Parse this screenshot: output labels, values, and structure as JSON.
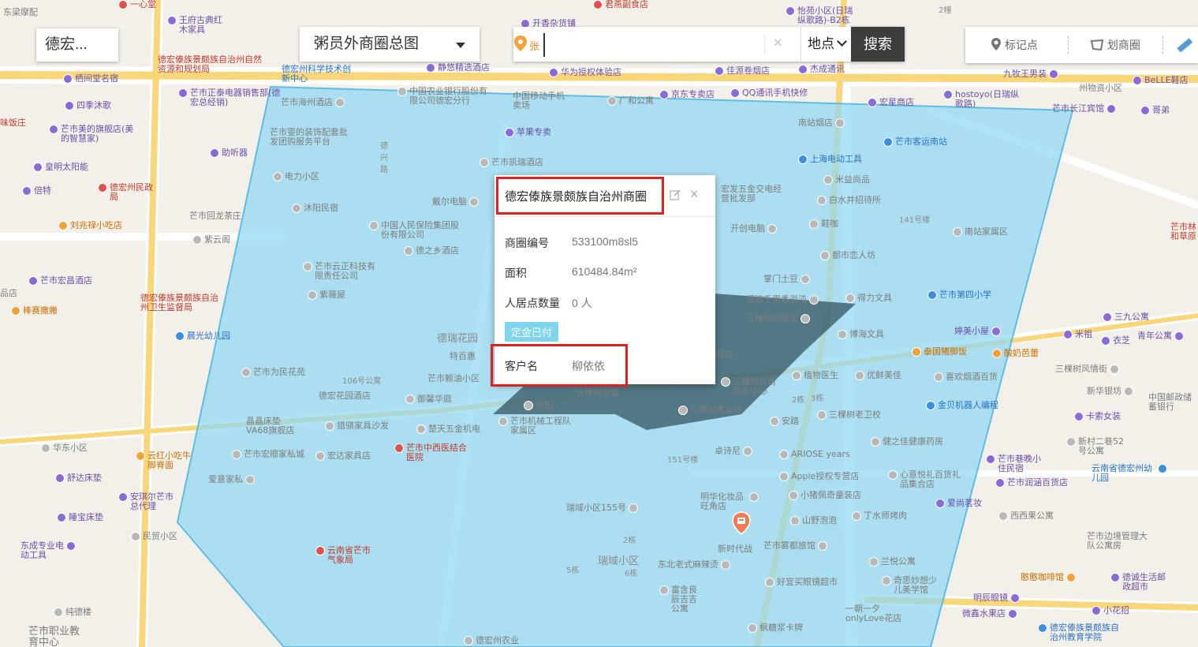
{
  "city_selector": {
    "label": "德宏..."
  },
  "area_selector": {
    "value": "粥员外商圈总图"
  },
  "search": {
    "partial_poi": "张",
    "input_value": "",
    "clear_label": "×",
    "type_label": "地点",
    "button_label": "搜索"
  },
  "tools": {
    "mark_label": "标记点",
    "draw_label": "划商圈",
    "mark_icon": "map-pin-icon",
    "draw_icon": "polygon-icon",
    "ruler_icon": "ruler-icon"
  },
  "colors": {
    "polygon_fill": "#8fd7f2",
    "highlight": "#e12020",
    "badge": "#7fd6ec",
    "search_button": "#3d3d3d"
  },
  "popup": {
    "title": "德宏傣族景颇族自治州商圈",
    "close_label": "×",
    "fields": [
      {
        "label": "商圈编号",
        "value": "533100m8sl5"
      },
      {
        "label": "面积",
        "value": "610484.84m²"
      },
      {
        "label": "人居点数量",
        "value": "0 人"
      }
    ],
    "badge": "定金已付",
    "customer": {
      "label": "客户名",
      "value": "柳依依"
    }
  },
  "map_labels": {
    "p1": "东梁摩配",
    "p2": "一心堂",
    "p3": "王府古典红木家具",
    "p4": "君燕副食店",
    "p5": "怡苑小区(日瑞纵歌路)-B2栋",
    "p6": "2幢",
    "p7": "德宏傣族景颇族自治州自然资源和规划局",
    "p8": "德宏州科学技术创新中心",
    "p9": "静悠精选酒店",
    "p10": "华为授权体验店",
    "p11": "佳源卷烟店",
    "p12": "杰成通讯",
    "p13": "九牧王男装",
    "p14": "BeLLE鞋店",
    "p15": "栖间堂名宿",
    "p16": "芒市正泰电器销售部(德宏总经销)",
    "p17": "中国农业银行股份有限公司德宏分行",
    "p18": "芒市海州酒店",
    "p19": "中国移动手机卖场",
    "p20": "广和公寓",
    "p21": "京东专卖店",
    "p22": "QQ通讯手机快修",
    "p23": "宏星商店",
    "p24": "hostoyo(日瑞纵歌路)",
    "p25": "州物资小区",
    "p26": "芒市长江宾馆",
    "p27": "哥弟",
    "p28": "四季沐歌",
    "p29": "芒市美的旗舰店(美的智慧家)",
    "p30": "芒市雯的装饰配套批发团购服务平台",
    "p31": "苹果专卖",
    "p32": "南站烟店",
    "p33": "芒市客运南站",
    "p34": "助听器",
    "p35": "皇明太阳能",
    "p36": "芒市凯瑞酒店",
    "p37": "上海电动工具",
    "p38": "倍特",
    "p39": "电力小区",
    "p40": "德兴路",
    "p41": "米益尚品",
    "p42": "德宏州民政局",
    "p43": "沐阳民宿",
    "p44": "宏发五金交电经营批发部",
    "p45": "白水井招待所",
    "p46": "芒市回龙茶庄",
    "p47": "戴尔电脑",
    "p48": "141号楼",
    "p49": "刘兆禄小吃店",
    "p50": "中国人民保险集团股份有限公司",
    "p51": "开创电脑",
    "p52": "鞋咖",
    "p53": "南站家属区",
    "p54": "紫云阁",
    "p55": "德之乡酒店",
    "p56": "都市恋人坊",
    "p57": "芒市云正科技有限责任公司",
    "p58": "掌门土豆",
    "p59": "福建千里香混沌",
    "p60": "得力文具",
    "p61": "芒市第四小学",
    "p62": "芒市宏昌酒店",
    "p63": "紫薇屋",
    "p64": "三棵树风情苑",
    "p65": "三九公寓",
    "p66": "德宏傣族景颇族自治州卫生监督局",
    "p67": "棒赛撒撇",
    "p68": "博海文具",
    "p69": "婷美小屋",
    "p70": "米祖",
    "p71": "衣芝",
    "p72": "青年公寓",
    "p73": "晨光幼儿园",
    "p74": "德瑞花园",
    "p75": "特百惠",
    "p76": "烟店",
    "p77": "泰国猪脚饭",
    "p78": "酸奶芭蕾",
    "p79": "三棵树风情街",
    "p80": "芒市为民花苑",
    "p81": "106号公寓",
    "p82": "芒市赖油小区",
    "p83": "植物医生",
    "p84": "优鲜美佳",
    "p85": "喜欢烟酒百货",
    "p86": "三棵树旺角商业中心",
    "p87": "新华银坊",
    "p88": "中国邮政储蓄银行",
    "p89": "德宏花园酒店",
    "p90": "御馨华庭",
    "p91": "佳田",
    "p92": "三棵树各客",
    "p93": "2栋",
    "p94": "3栋",
    "p95": "金贝机器人编程",
    "p96": "芒市机械工程队家属区",
    "p97": "三棵树客运站",
    "p98": "三棵树老卫校",
    "p99": "卡索女装",
    "p100": "晶晶床垫VA68旗舰店",
    "p101": "猎骐家具沙发",
    "p102": "楚天五金机电",
    "p103": "安踏",
    "p104": "新村二巷52号公寓",
    "p105": "华东小区",
    "p106": "芒市中西医结合医院",
    "p107": "151号楼",
    "p108": "卓诗尼",
    "p109": "健之佳健康药房",
    "p110": "云红小吃牛脚脊面",
    "p111": "芒市宏顺家私城",
    "p112": "宏达家具店",
    "p113": "ARIOSE years",
    "p114": "芒市巷晚小住民宿",
    "p115": "舒达床垫",
    "p116": "爱意家私",
    "p117": "Apple授权专营店",
    "p118": "心意悦礼百货礼品集合店",
    "p119": "芒市润涵百货店",
    "p120": "云南省德宏州幼儿园",
    "p121": "安琪尔芒市总代理",
    "p122": "明华化妆品旺角店",
    "p123": "小猪佩奇童装店",
    "p124": "爱尚茗妆",
    "p125": "西西果公寓",
    "p126": "睡宝床垫",
    "p127": "瑞域小区155号",
    "p128": "山野泡泡",
    "p129": "丁水师烤肉",
    "p130": "东成专业电动工具",
    "p131": "民贸小区",
    "p132": "2栋",
    "p133": "新时代战",
    "p134": "芒市雾都旅馆",
    "p135": "芒市边境管理大队公寓房",
    "p136": "云南省芒市气象局",
    "p137": "瑞域小区",
    "p138": "5栋",
    "p139": "6栋",
    "p140": "东北老式麻辣烫",
    "p141": "兰悦公寓",
    "p142": "憨憨咖啡馆",
    "p143": "德诚生活邮政超市",
    "p144": "奇思妙想少儿美学馆",
    "p145": "好宜买眼镜超市",
    "p146": "明辰眼镜",
    "p147": "纯德楼",
    "p148": "富含良辰吉吉公寓",
    "p149": "一朝一夕onlyLove花店",
    "p150": "微鑫水果店",
    "p151": "小花招",
    "p152": "芒市职业教育中心",
    "p153": "枫糖浆卡牌",
    "p154": "德宏傣族景颇族自治州教育学院",
    "p155": "德宏州农业",
    "p156": "芒市林和草原",
    "p157": "味饭庄",
    "p158": "品店",
    "p159": "开香杂货铺"
  }
}
